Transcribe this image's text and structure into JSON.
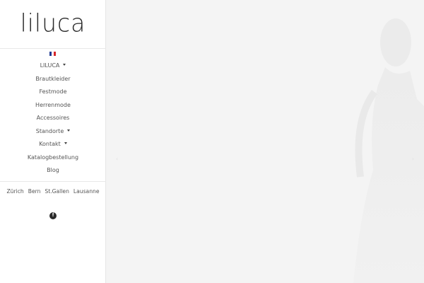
{
  "brand": {
    "logo_text": "liluca"
  },
  "language": {
    "flag": "fr",
    "flag_colors": [
      "#1f3a93",
      "#ffffff",
      "#d6262b"
    ]
  },
  "nav": {
    "items": [
      {
        "label": "LILUCA",
        "dropdown": true
      },
      {
        "label": "Brautkleider",
        "dropdown": false
      },
      {
        "label": "Festmode",
        "dropdown": false
      },
      {
        "label": "Herrenmode",
        "dropdown": false
      },
      {
        "label": "Accessoires",
        "dropdown": false
      },
      {
        "label": "Standorte",
        "dropdown": true
      },
      {
        "label": "Kontakt",
        "dropdown": true
      },
      {
        "label": "Katalogbestellung",
        "dropdown": false
      },
      {
        "label": "Blog",
        "dropdown": false
      }
    ]
  },
  "locations": [
    "Zürich",
    "Bern",
    "St.Gallen",
    "Lausanne"
  ],
  "social": {
    "facebook_icon": "facebook-icon",
    "glyph": "f"
  },
  "slider": {
    "prev_arrow": "‹",
    "next_arrow": "›",
    "background": "#f4f4f4"
  }
}
